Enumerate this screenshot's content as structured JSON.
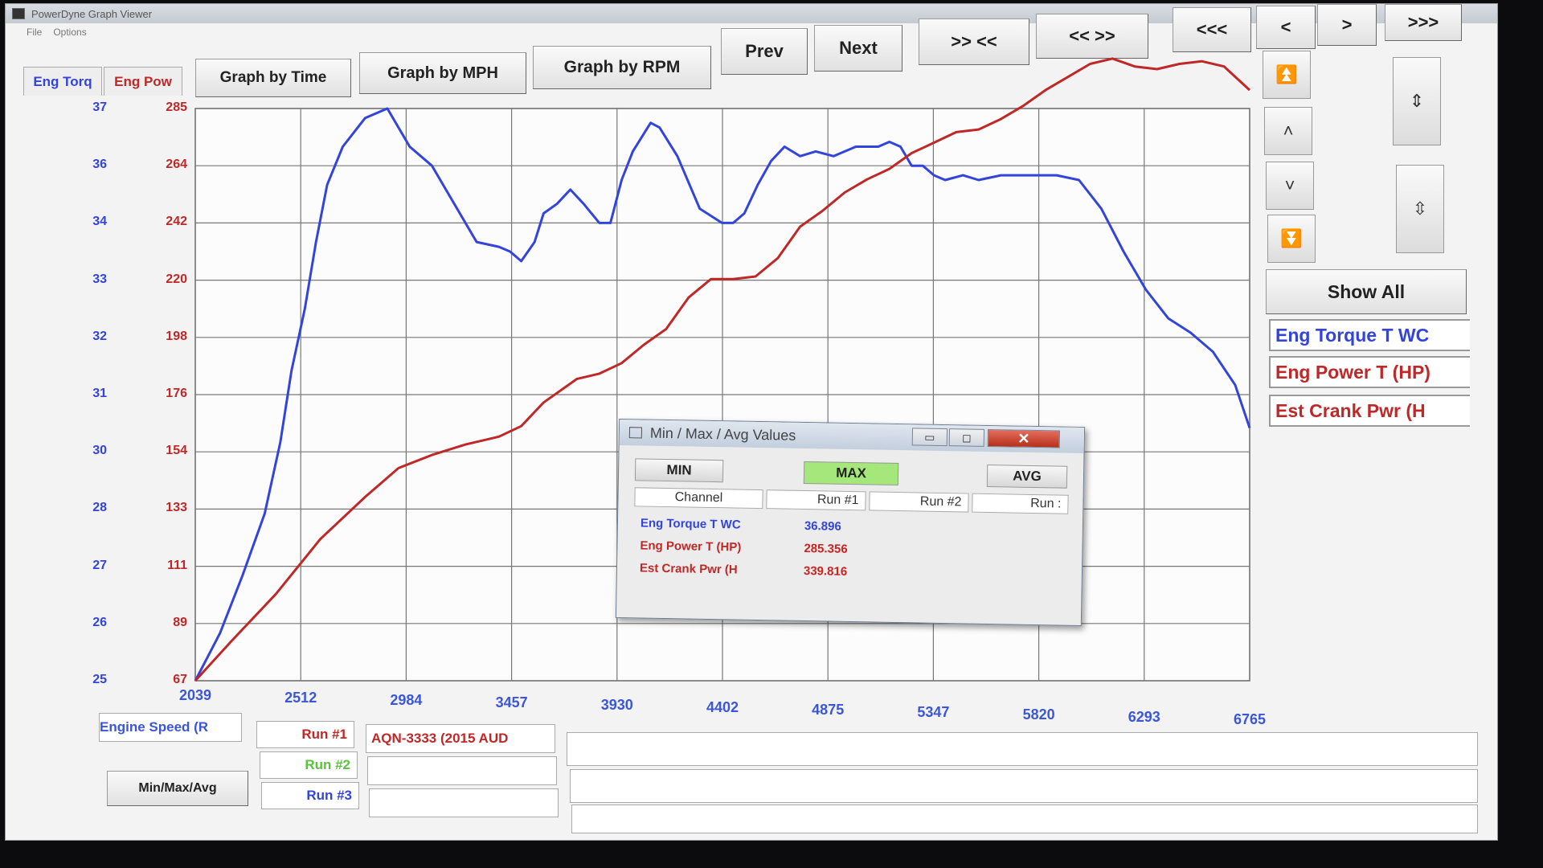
{
  "window": {
    "title": "PowerDyne Graph Viewer"
  },
  "menu": {
    "items": [
      "File",
      "Options"
    ]
  },
  "tabs": {
    "eng_torq": "Eng Torq",
    "eng_pow": "Eng Pow",
    "by_time": "Graph by Time",
    "by_mph": "Graph by MPH",
    "by_rpm": "Graph by RPM"
  },
  "toolbar": {
    "prev": "Prev",
    "next": "Next",
    "zoom_in": ">> <<",
    "zoom_out": "<< >>",
    "first": "<<<",
    "back": "<",
    "forward": ">",
    "last": ">>>"
  },
  "side": {
    "show_all": "Show All",
    "legend": [
      "Eng Torque T WC",
      "Eng Power T (HP)",
      "Est Crank Pwr (H"
    ]
  },
  "colors": {
    "torque": "#3344dd",
    "power": "#c02828",
    "max_active": "#a6e77c"
  },
  "chart_data": {
    "type": "line",
    "xlabel": "Engine Speed (R",
    "x_ticks": [
      "2039",
      "2512",
      "2984",
      "3457",
      "3930",
      "4402",
      "4875",
      "5347",
      "5820",
      "6293",
      "6765"
    ],
    "y_ticks_torque": [
      "25",
      "26",
      "27",
      "28",
      "30",
      "31",
      "32",
      "33",
      "34",
      "36",
      "37"
    ],
    "y_ticks_power": [
      "67",
      "89",
      "111",
      "133",
      "154",
      "176",
      "198",
      "220",
      "242",
      "264",
      "285"
    ],
    "xlim": [
      2039,
      6765
    ],
    "ylim_torque": [
      25,
      37
    ],
    "ylim_power": [
      67,
      285
    ],
    "grid": true,
    "series": [
      {
        "name": "Eng Torque T WC",
        "axis": "torque",
        "x": [
          2039,
          2150,
          2250,
          2350,
          2420,
          2470,
          2530,
          2580,
          2630,
          2700,
          2800,
          2900,
          3000,
          3100,
          3200,
          3300,
          3400,
          3450,
          3500,
          3560,
          3600,
          3660,
          3720,
          3780,
          3850,
          3900,
          3950,
          4000,
          4080,
          4120,
          4200,
          4300,
          4400,
          4450,
          4500,
          4560,
          4620,
          4680,
          4750,
          4820,
          4900,
          5000,
          5100,
          5150,
          5200,
          5250,
          5300,
          5350,
          5400,
          5480,
          5550,
          5650,
          5750,
          5820,
          5900,
          6000,
          6100,
          6200,
          6300,
          6400,
          6500,
          6600,
          6700,
          6765
        ],
        "y": [
          25.0,
          26.0,
          27.2,
          28.5,
          30.0,
          31.5,
          32.8,
          34.2,
          35.4,
          36.2,
          36.8,
          37.0,
          36.2,
          35.8,
          35.0,
          34.2,
          34.1,
          34.0,
          33.8,
          34.2,
          34.8,
          35.0,
          35.3,
          35.0,
          34.6,
          34.6,
          35.5,
          36.1,
          36.7,
          36.6,
          36.0,
          34.9,
          34.6,
          34.6,
          34.8,
          35.4,
          35.9,
          36.2,
          36.0,
          36.1,
          36.0,
          36.2,
          36.2,
          36.3,
          36.2,
          35.8,
          35.8,
          35.6,
          35.5,
          35.6,
          35.5,
          35.6,
          35.6,
          35.6,
          35.6,
          35.5,
          34.9,
          34.0,
          33.2,
          32.6,
          32.3,
          31.9,
          31.2,
          30.3
        ]
      },
      {
        "name": "Eng Power T (HP)",
        "axis": "power",
        "x": [
          2039,
          2200,
          2400,
          2600,
          2800,
          2950,
          3100,
          3250,
          3400,
          3500,
          3600,
          3750,
          3850,
          3950,
          4050,
          4150,
          4250,
          4350,
          4450,
          4550,
          4650,
          4750,
          4850,
          4950,
          5050,
          5150,
          5250,
          5350,
          5450,
          5550,
          5650,
          5750,
          5850,
          5950,
          6050,
          6150,
          6250,
          6350,
          6450,
          6550,
          6650,
          6765
        ],
        "y": [
          67,
          82,
          100,
          121,
          137,
          148,
          153,
          157,
          160,
          164,
          173,
          182,
          184,
          188,
          195,
          201,
          213,
          220,
          220,
          221,
          228,
          240,
          246,
          253,
          258,
          262,
          268,
          272,
          276,
          277,
          281,
          286,
          292,
          297,
          302,
          304,
          301,
          300,
          302,
          303,
          301,
          292
        ]
      }
    ]
  },
  "dialog": {
    "title": "Min / Max / Avg Values",
    "buttons": {
      "min": "MIN",
      "max": "MAX",
      "avg": "AVG"
    },
    "columns": [
      "Channel",
      "Run #1",
      "Run #2",
      "Run :"
    ],
    "rows": [
      {
        "label": "Eng Torque T WC",
        "value": "36.896"
      },
      {
        "label": "Eng Power T (HP)",
        "value": "285.356"
      },
      {
        "label": "Est Crank Pwr (H",
        "value": "339.816"
      }
    ]
  },
  "bottom": {
    "channel": "Engine Speed (R",
    "minmax_button": "Min/Max/Avg",
    "runs": [
      "Run #1",
      "Run #2",
      "Run #3"
    ],
    "run_desc": "AQN-3333 (2015 AUD"
  }
}
